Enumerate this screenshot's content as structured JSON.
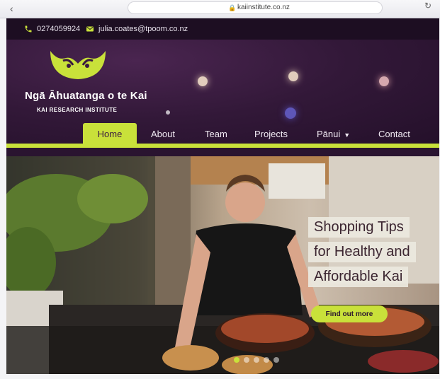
{
  "browser": {
    "address": "kaiinstitute.co.nz"
  },
  "topbar": {
    "phone": "0274059924",
    "email": "julia.coates@tpoom.co.nz"
  },
  "header": {
    "site_name": "Ngā Āhuatanga o te Kai",
    "tagline": "KAI RESEARCH INSTITUTE",
    "logo_icon": "kai-koru-logo-icon",
    "brand_color": "#c9e13a"
  },
  "nav": {
    "items": [
      {
        "label": "Home",
        "active": true
      },
      {
        "label": "About"
      },
      {
        "label": "Team"
      },
      {
        "label": "Projects"
      },
      {
        "label": "Pānui",
        "has_dropdown": true
      },
      {
        "label": "Contact"
      }
    ]
  },
  "hero": {
    "headline": [
      "Shopping Tips",
      "for Healthy and",
      "Affordable Kai"
    ],
    "cta": "Find out more",
    "slide_count": 5,
    "active_slide": 1
  }
}
